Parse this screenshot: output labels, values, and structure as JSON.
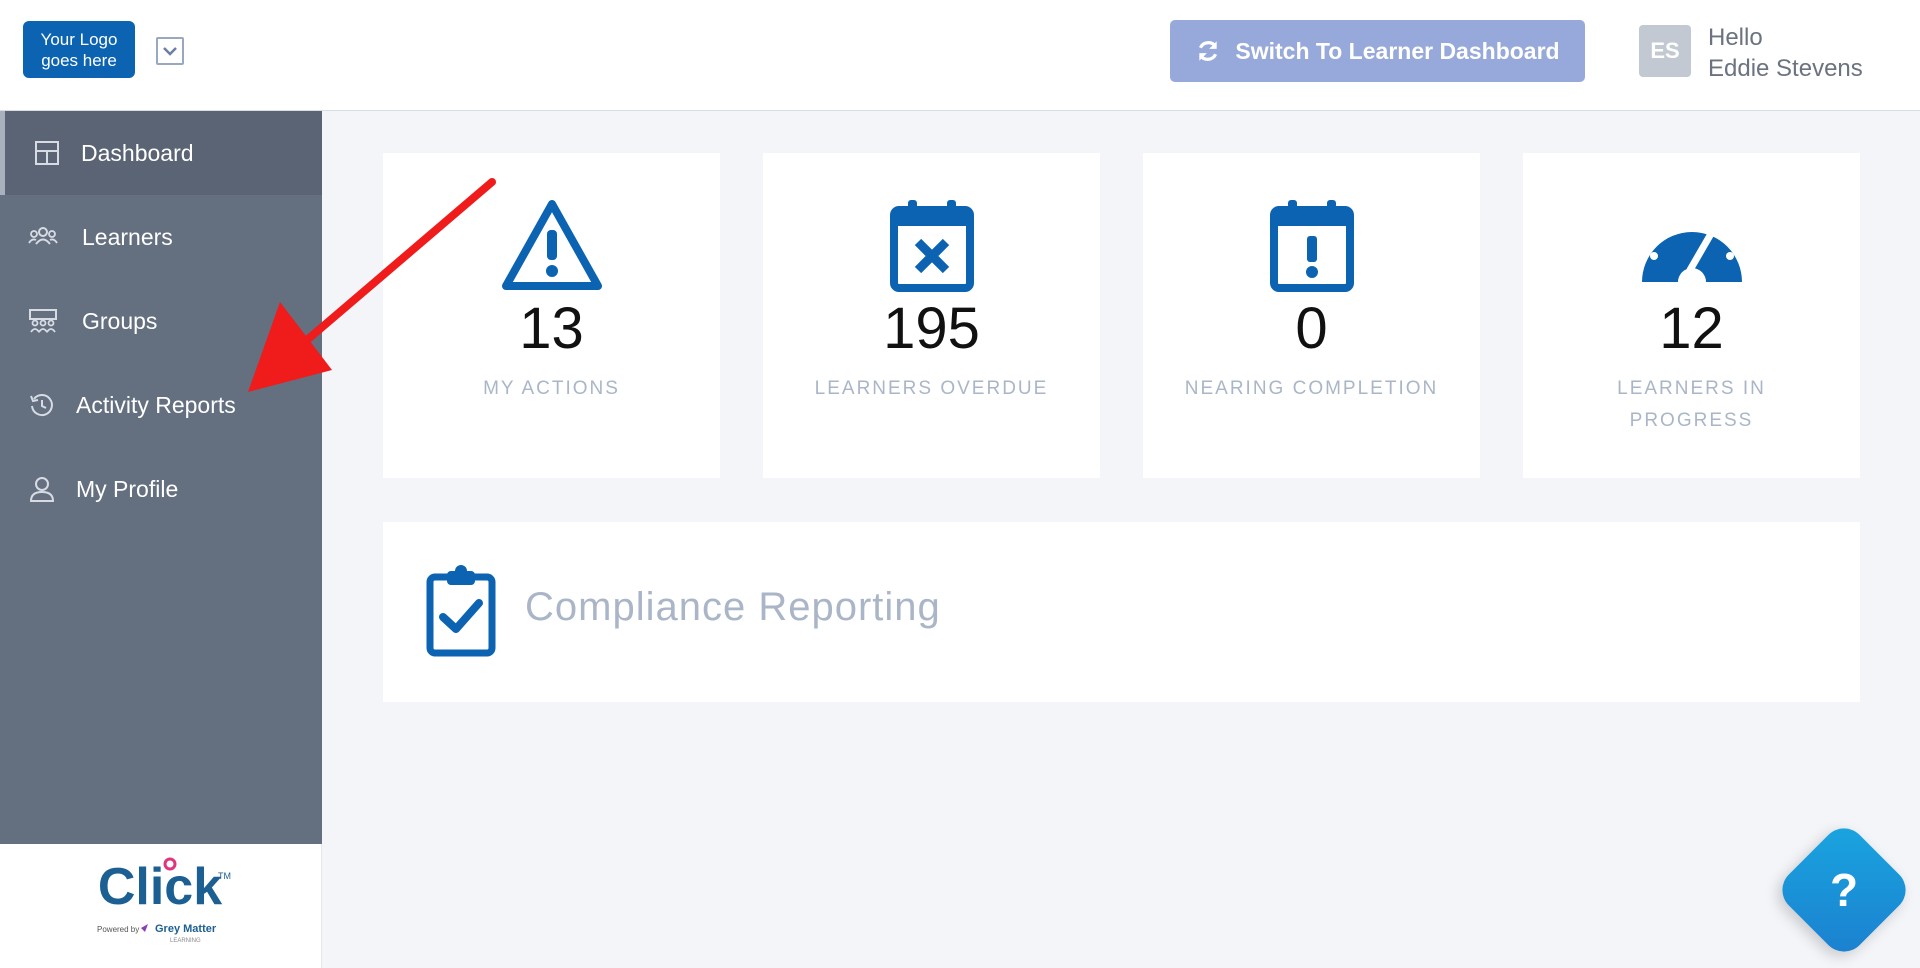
{
  "header": {
    "logo_text": "Your Logo goes here",
    "switch_button_label": "Switch To Learner Dashboard",
    "avatar_initials": "ES",
    "greeting": "Hello",
    "user_name": "Eddie Stevens"
  },
  "sidebar": {
    "items": [
      {
        "label": "Dashboard",
        "icon": "dashboard-grid-icon",
        "active": true
      },
      {
        "label": "Learners",
        "icon": "users-icon",
        "active": false
      },
      {
        "label": "Groups",
        "icon": "groups-icon",
        "active": false
      },
      {
        "label": "Activity Reports",
        "icon": "history-icon",
        "active": false
      },
      {
        "label": "My Profile",
        "icon": "user-icon",
        "active": false
      }
    ],
    "brand": {
      "name": "Click",
      "trademark": "TM",
      "powered_by": "Powered by",
      "partner": "Grey Matter",
      "partner_sub": "LEARNING"
    }
  },
  "stats": [
    {
      "value": "13",
      "label": "MY ACTIONS",
      "icon": "warning-triangle-icon"
    },
    {
      "value": "195",
      "label": "LEARNERS OVERDUE",
      "icon": "calendar-x-icon"
    },
    {
      "value": "0",
      "label": "NEARING COMPLETION",
      "icon": "calendar-exclamation-icon"
    },
    {
      "value": "12",
      "label": "LEARNERS IN PROGRESS",
      "icon": "speedometer-icon"
    }
  ],
  "compliance": {
    "title": "Compliance Reporting",
    "icon": "clipboard-check-icon"
  },
  "help": {
    "label": "?"
  },
  "colors": {
    "primary": "#0b63b2",
    "sidebar": "#646f80",
    "switch_button": "#97a9da",
    "muted_text": "#aab6c8",
    "annotation_arrow": "#f01b1b"
  }
}
